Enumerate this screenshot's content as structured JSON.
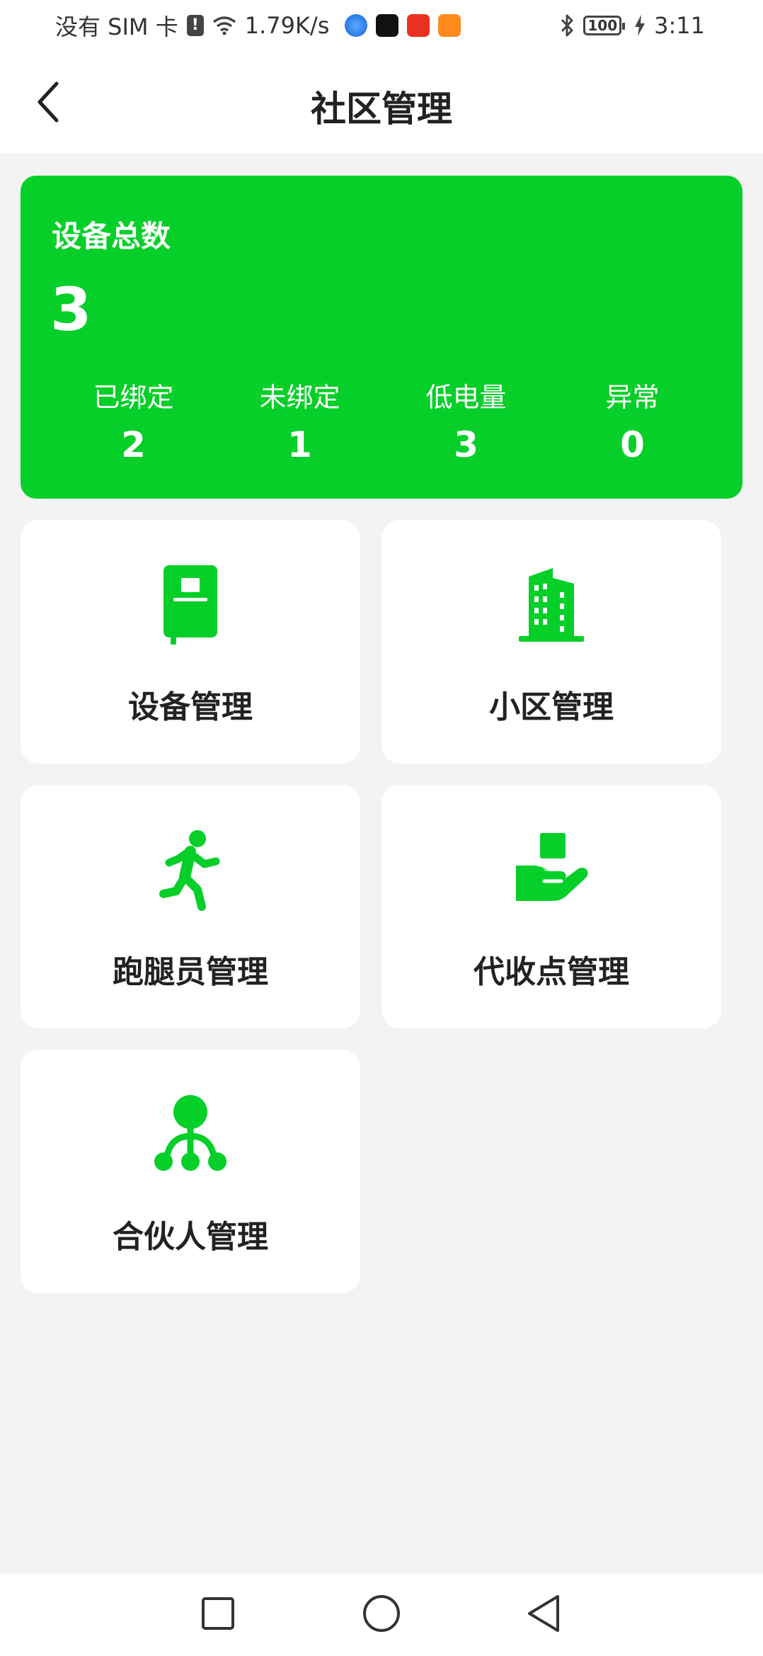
{
  "status_bar": {
    "carrier": "没有 SIM 卡",
    "alert_glyph": "!",
    "speed": "1.79K/s",
    "battery": "100",
    "time": "3:11"
  },
  "header": {
    "title": "社区管理"
  },
  "summary": {
    "title": "设备总数",
    "total": "3",
    "stats": [
      {
        "label": "已绑定",
        "value": "2"
      },
      {
        "label": "未绑定",
        "value": "1"
      },
      {
        "label": "低电量",
        "value": "3"
      },
      {
        "label": "异常",
        "value": "0"
      }
    ]
  },
  "menu": [
    {
      "label": "设备管理",
      "icon": "device-icon"
    },
    {
      "label": "小区管理",
      "icon": "building-icon"
    },
    {
      "label": "跑腿员管理",
      "icon": "runner-icon"
    },
    {
      "label": "代收点管理",
      "icon": "hand-package-icon"
    },
    {
      "label": "合伙人管理",
      "icon": "network-icon"
    }
  ],
  "colors": {
    "accent": "#05cf28",
    "background": "#f3f3f3",
    "card": "#ffffff"
  }
}
